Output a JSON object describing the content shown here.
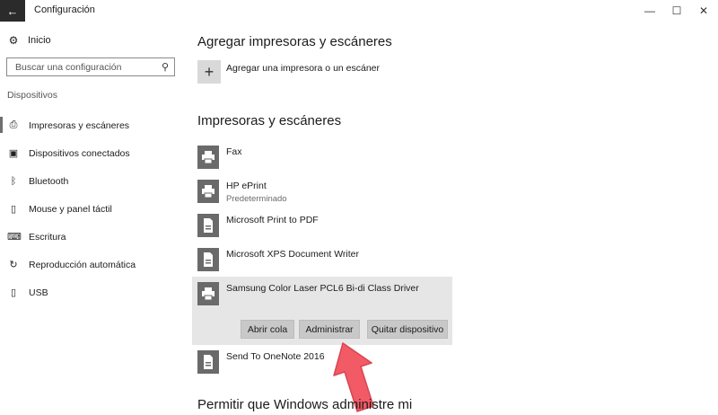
{
  "window": {
    "title": "Configuración",
    "back_icon": "←",
    "minimize_icon": "—",
    "maximize_icon": "☐",
    "close_icon": "✕"
  },
  "sidebar": {
    "home_label": "Inicio",
    "home_icon": "⚙",
    "search_placeholder": "Buscar una configuración",
    "search_icon": "⚲",
    "section_label": "Dispositivos",
    "items": [
      {
        "label": "Impresoras y escáneres",
        "icon": "⎙",
        "active": true
      },
      {
        "label": "Dispositivos conectados",
        "icon": "▣",
        "active": false
      },
      {
        "label": "Bluetooth",
        "icon": "ᛒ",
        "active": false
      },
      {
        "label": "Mouse y panel táctil",
        "icon": "▯",
        "active": false
      },
      {
        "label": "Escritura",
        "icon": "⌨",
        "active": false
      },
      {
        "label": "Reproducción automática",
        "icon": "↻",
        "active": false
      },
      {
        "label": "USB",
        "icon": "▯",
        "active": false
      }
    ]
  },
  "main": {
    "add_section_title": "Agregar impresoras y escáneres",
    "add_button_label": "Agregar una impresora o un escáner",
    "add_icon": "+",
    "printers_title": "Impresoras y escáneres",
    "devices": [
      {
        "name": "Fax",
        "sub": "",
        "icon": "printer-icon"
      },
      {
        "name": "HP ePrint",
        "sub": "Predeterminado",
        "icon": "printer-icon"
      },
      {
        "name": "Microsoft Print to PDF",
        "sub": "",
        "icon": "document-printer-icon"
      },
      {
        "name": "Microsoft XPS Document Writer",
        "sub": "",
        "icon": "document-printer-icon"
      },
      {
        "name": "Samsung Color Laser PCL6 Bi-di Class Driver",
        "sub": "",
        "icon": "printer-icon",
        "selected": true
      },
      {
        "name": "Send To OneNote 2016",
        "sub": "",
        "icon": "document-printer-icon"
      }
    ],
    "actions": {
      "open_queue": "Abrir cola",
      "manage": "Administrar",
      "remove": "Quitar dispositivo"
    },
    "bottom_title": "Permitir que Windows administre mi"
  },
  "colors": {
    "selected_bg": "#e6e6e6",
    "button_bg": "#c8c8c8",
    "device_icon_bg": "#6a6a6a",
    "arrow": "#f25a66"
  }
}
